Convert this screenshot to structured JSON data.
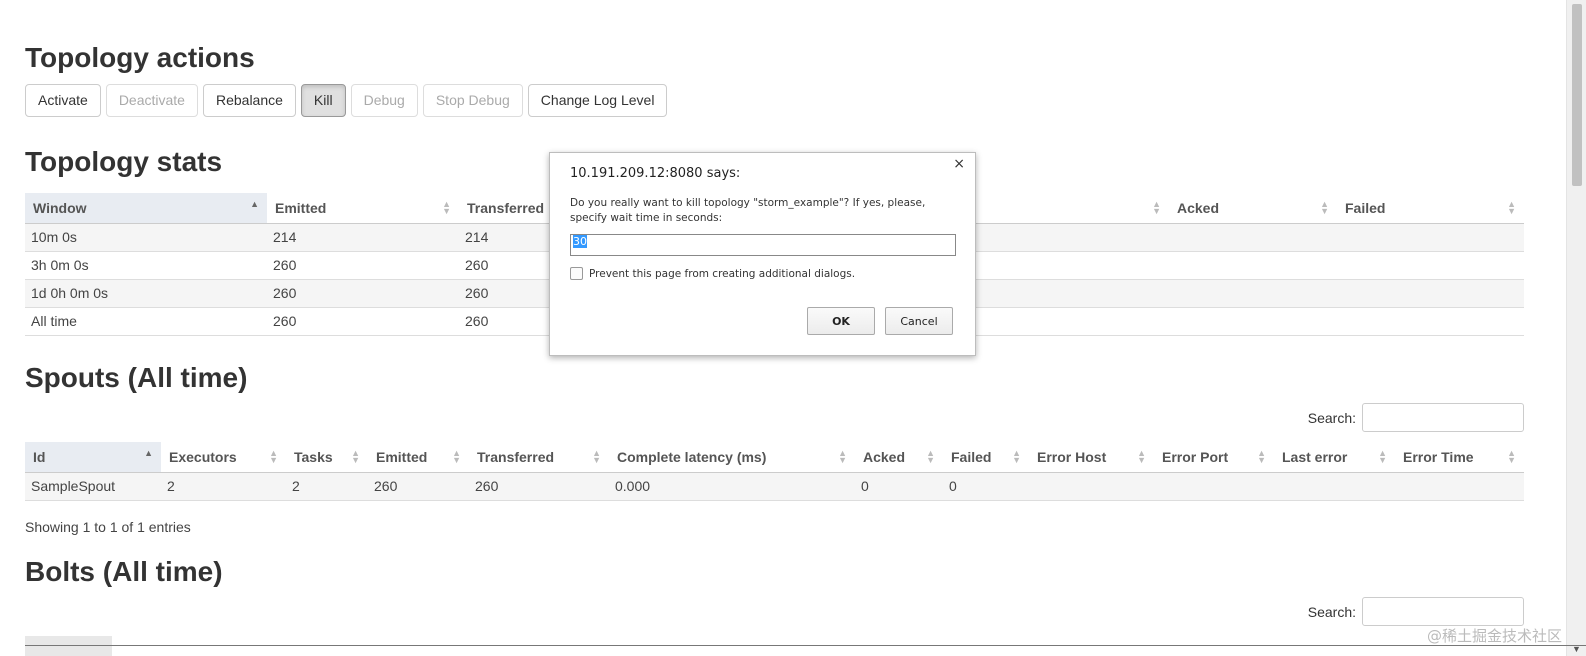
{
  "actions": {
    "heading": "Topology actions",
    "buttons": [
      "Activate",
      "Deactivate",
      "Rebalance",
      "Kill",
      "Debug",
      "Stop Debug",
      "Change Log Level"
    ]
  },
  "stats": {
    "heading": "Topology stats",
    "columns": [
      "Window",
      "Emitted",
      "Transferred",
      "Acked",
      "Failed"
    ],
    "rows": [
      [
        "10m 0s",
        "214",
        "214"
      ],
      [
        "3h 0m 0s",
        "260",
        "260"
      ],
      [
        "1d 0h 0m 0s",
        "260",
        "260"
      ],
      [
        "All time",
        "260",
        "260"
      ]
    ]
  },
  "spouts": {
    "heading": "Spouts (All time)",
    "search_label": "Search:",
    "columns": [
      "Id",
      "Executors",
      "Tasks",
      "Emitted",
      "Transferred",
      "Complete latency (ms)",
      "Acked",
      "Failed",
      "Error Host",
      "Error Port",
      "Last error",
      "Error Time"
    ],
    "rows": [
      [
        "SampleSpout",
        "2",
        "2",
        "260",
        "260",
        "0.000",
        "0",
        "0",
        "",
        "",
        "",
        ""
      ]
    ],
    "info": "Showing 1 to 1 of 1 entries"
  },
  "bolts": {
    "heading": "Bolts (All time)",
    "search_label": "Search:"
  },
  "dialog": {
    "title": "10.191.209.12:8080 says:",
    "close": "×",
    "message": "Do you really want to kill topology \"storm_example\"? If yes, please, specify wait time in seconds:",
    "input_value": "30",
    "checkbox_label": "Prevent this page from creating additional dialogs.",
    "ok_label": "OK",
    "cancel_label": "Cancel"
  },
  "watermark": "@稀土掘金技术社区"
}
